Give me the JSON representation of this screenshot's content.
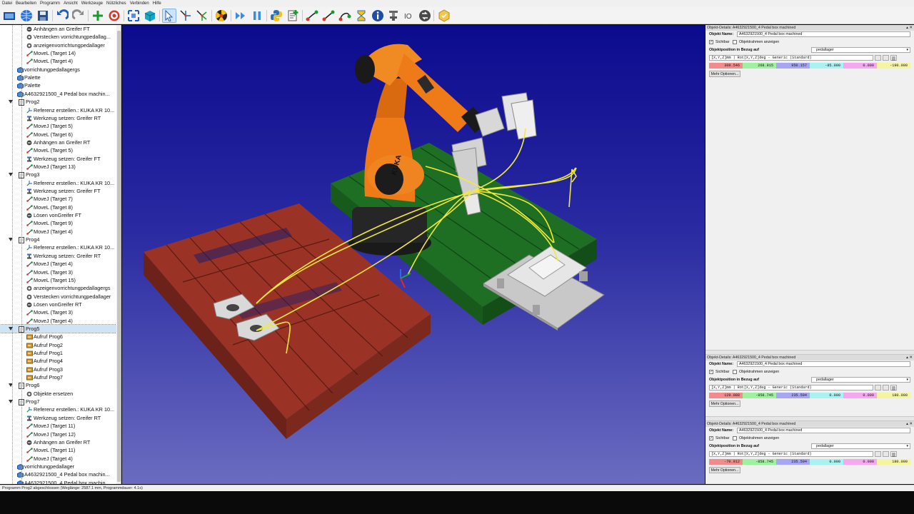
{
  "menu": [
    "Datei",
    "Bearbeiten",
    "Programm",
    "Ansicht",
    "Werkzeuge",
    "Nützliches",
    "Verbinden",
    "Hilfe"
  ],
  "tree": [
    {
      "label": "Anhängen an Greifer FT",
      "icon": "attach-icon",
      "level": 3
    },
    {
      "label": "Verstecken vorrichtungpedallag...",
      "icon": "gear-icon",
      "level": 3
    },
    {
      "label": "anzeigenvorrichtungpedallager",
      "icon": "gear-icon",
      "level": 3
    },
    {
      "label": "MoveL (Target 14)",
      "icon": "movel-icon",
      "level": 3
    },
    {
      "label": "MoveL (Target 4)",
      "icon": "movel-icon",
      "level": 3
    },
    {
      "label": "vorrichtungpedallagergs",
      "icon": "object-icon",
      "level": 2
    },
    {
      "label": "Palette",
      "icon": "object-icon",
      "level": 2
    },
    {
      "label": "Palette",
      "icon": "object-icon",
      "level": 2
    },
    {
      "label": "A4632921500_4 Pedal box machin...",
      "icon": "object-icon",
      "level": 2
    },
    {
      "label": "Prog2",
      "icon": "program-icon",
      "level": 1,
      "expander": true
    },
    {
      "label": "Referenz erstellen.: KUKA KR 10...",
      "icon": "reference-icon",
      "level": 3
    },
    {
      "label": "Werkzeug setzen: Greifer RT",
      "icon": "tool-icon",
      "level": 3
    },
    {
      "label": "MoveJ (Target 5)",
      "icon": "movej-icon",
      "level": 3
    },
    {
      "label": "MoveL (Target 6)",
      "icon": "movel-icon",
      "level": 3
    },
    {
      "label": "Anhängen an Greifer RT",
      "icon": "attach-icon",
      "level": 3
    },
    {
      "label": "MoveL (Target 5)",
      "icon": "movel-icon",
      "level": 3
    },
    {
      "label": "Werkzeug setzen: Greifer FT",
      "icon": "tool-icon",
      "level": 3
    },
    {
      "label": "MoveJ (Target 13)",
      "icon": "movej-icon",
      "level": 3
    },
    {
      "label": "Prog3",
      "icon": "program-icon",
      "level": 1,
      "expander": true
    },
    {
      "label": "Referenz erstellen.: KUKA KR 10...",
      "icon": "reference-icon",
      "level": 3
    },
    {
      "label": "Werkzeug setzen: Greifer FT",
      "icon": "tool-icon",
      "level": 3
    },
    {
      "label": "MoveJ (Target 7)",
      "icon": "movej-icon",
      "level": 3
    },
    {
      "label": "MoveL (Target 8)",
      "icon": "movel-icon",
      "level": 3
    },
    {
      "label": "Lösen vonGreifer FT",
      "icon": "attach-icon",
      "level": 3
    },
    {
      "label": "MoveL (Target 9)",
      "icon": "movel-icon",
      "level": 3
    },
    {
      "label": "MoveJ (Target 4)",
      "icon": "movej-icon",
      "level": 3
    },
    {
      "label": "Prog4",
      "icon": "program-icon",
      "level": 1,
      "expander": true
    },
    {
      "label": "Referenz erstellen.: KUKA KR 10...",
      "icon": "reference-icon",
      "level": 3
    },
    {
      "label": "Werkzeug setzen: Greifer RT",
      "icon": "tool-icon",
      "level": 3
    },
    {
      "label": "MoveJ (Target 4)",
      "icon": "movej-icon",
      "level": 3
    },
    {
      "label": "MoveL (Target 3)",
      "icon": "movel-icon",
      "level": 3
    },
    {
      "label": "MoveL (Target 15)",
      "icon": "movel-icon",
      "level": 3
    },
    {
      "label": "anzeigenvorrichtungpedallagergs",
      "icon": "gear-icon",
      "level": 3
    },
    {
      "label": "Verstecken vorrichtungpedallager",
      "icon": "gear-icon",
      "level": 3
    },
    {
      "label": "Lösen vonGreifer RT",
      "icon": "attach-icon",
      "level": 3
    },
    {
      "label": "MoveL (Target 3)",
      "icon": "movel-icon",
      "level": 3
    },
    {
      "label": "MoveJ (Target 4)",
      "icon": "movej-icon",
      "level": 3
    },
    {
      "label": "Prog5",
      "icon": "program-icon",
      "level": 1,
      "expander": true,
      "selected": true
    },
    {
      "label": "Aufruf Prog6",
      "icon": "call-icon",
      "level": 3
    },
    {
      "label": "Aufruf Prog2",
      "icon": "call-icon",
      "level": 3
    },
    {
      "label": "Aufruf Prog1",
      "icon": "call-icon",
      "level": 3
    },
    {
      "label": "Aufruf Prog4",
      "icon": "call-icon",
      "level": 3
    },
    {
      "label": "Aufruf Prog3",
      "icon": "call-icon",
      "level": 3
    },
    {
      "label": "Aufruf Prog7",
      "icon": "call-icon",
      "level": 3
    },
    {
      "label": "Prog6",
      "icon": "program-icon",
      "level": 1,
      "expander": true
    },
    {
      "label": "Objekte ersetzen",
      "icon": "gear-icon",
      "level": 3
    },
    {
      "label": "Prog7",
      "icon": "program-icon",
      "level": 1,
      "expander": true
    },
    {
      "label": "Referenz erstellen.: KUKA KR 10...",
      "icon": "reference-icon",
      "level": 3
    },
    {
      "label": "Werkzeug setzen: Greifer RT",
      "icon": "tool-icon",
      "level": 3
    },
    {
      "label": "MoveJ (Target 11)",
      "icon": "movej-icon",
      "level": 3
    },
    {
      "label": "MoveJ (Target 12)",
      "icon": "movej-icon",
      "level": 3
    },
    {
      "label": "Anhängen an Greifer RT",
      "icon": "attach-icon",
      "level": 3
    },
    {
      "label": "MoveL (Target 11)",
      "icon": "movel-icon",
      "level": 3
    },
    {
      "label": "MoveJ (Target 4)",
      "icon": "movej-icon",
      "level": 3
    },
    {
      "label": "vorrichtungpedallager",
      "icon": "object-icon",
      "level": 2
    },
    {
      "label": "A4632921500_4 Pedal box machin...",
      "icon": "object-icon",
      "level": 2
    },
    {
      "label": "A4632921500_4 Pedal box machin...",
      "icon": "object-icon",
      "level": 2
    }
  ],
  "viewport": {
    "robot_brand": "KUKA"
  },
  "panels": [
    {
      "title": "Objekt-Details: A4632921500_4 Pedal box machined",
      "name_label": "Objekt Name:",
      "name_value": "A4632921500_4 Pedal box machined",
      "visible_label": "Sichtbar",
      "visible_checked": true,
      "frame_label": "Objektrahmen anzeigen",
      "frame_checked": false,
      "pos_label": "Objektposition in Bezug auf",
      "ref_value": "pedallager",
      "format_value": "[X,Y,Z]mm | Rot[X,Y,Z]deg - Generic (Standard)",
      "values": [
        "309.546",
        "268.915",
        "950.157",
        "-85.000",
        "0.000",
        "-190.000"
      ],
      "more_label": "Mehr Optionen..."
    },
    {
      "title": "Objekt-Details: A4632921500_4 Pedal box machined",
      "name_label": "Objekt Name:",
      "name_value": "A4632921500_4 Pedal box machined",
      "visible_label": "Sichtbar",
      "visible_checked": true,
      "frame_label": "Objektrahmen anzeigen",
      "frame_checked": false,
      "pos_label": "Objektposition in Bezug auf",
      "ref_value": "pedallager",
      "format_value": "[X,Y,Z]mm | Rot[X,Y,Z]deg - Generic (Standard)",
      "values": [
        "129.088",
        "-858.745",
        "235.594",
        "0.000",
        "0.000",
        "180.000"
      ],
      "more_label": "Mehr Optionen..."
    },
    {
      "title": "Objekt-Details: A4632921500_4 Pedal box machined",
      "name_label": "Objekt Name:",
      "name_value": "A4632921500_4 Pedal box machined",
      "visible_label": "Sichtbar",
      "visible_checked": true,
      "frame_label": "Objektrahmen anzeigen",
      "frame_checked": false,
      "pos_label": "Objektposition in Bezug auf",
      "ref_value": "pedallager",
      "format_value": "[X,Y,Z]mm | Rot[X,Y,Z]deg - Generic (Standard)",
      "values": [
        "-70.912",
        "-858.745",
        "235.594",
        "0.000",
        "0.000",
        "180.000"
      ],
      "more_label": "Mehr Optionen..."
    }
  ],
  "value_colors": [
    "#f28b8b",
    "#9ff09f",
    "#a6a6f5",
    "#a8f2f2",
    "#f5a8f0",
    "#f5f5a0"
  ],
  "status": "Programm Prog2 abgeschlossen (Weglänge: 2587.1 mm, Programmdauer: 4.1s)"
}
